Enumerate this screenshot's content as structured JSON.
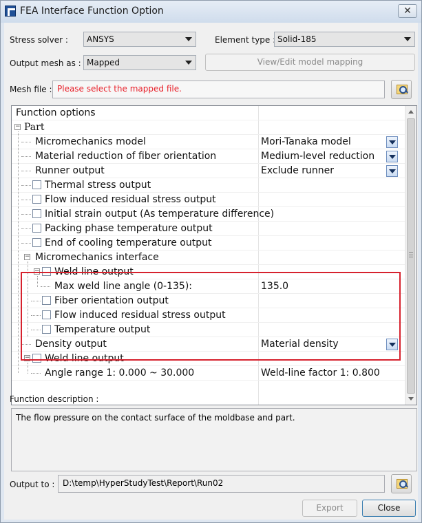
{
  "window": {
    "title": "FEA Interface Function Option",
    "close_glyph": "✕"
  },
  "stress_solver": {
    "label": "Stress solver :",
    "value": "ANSYS"
  },
  "element_type": {
    "label": "Element type :",
    "value": "Solid-185"
  },
  "output_mesh": {
    "label": "Output mesh as :",
    "value": "Mapped"
  },
  "view_edit_button": "View/Edit model mapping",
  "mesh_file": {
    "label": "Mesh file :",
    "value": "Please select the mapped file.",
    "value_color": "#e8212b"
  },
  "grid": {
    "header": "Function options",
    "rows": [
      {
        "text": "Part"
      },
      {
        "text": "Micromechanics model",
        "value": "Mori-Tanaka model"
      },
      {
        "text": "Material reduction of fiber orientation",
        "value": "Medium-level reduction"
      },
      {
        "text": "Runner output",
        "value": "Exclude runner"
      },
      {
        "text": "Thermal stress output"
      },
      {
        "text": "Flow induced residual stress output"
      },
      {
        "text": "Initial strain output (As temperature difference)"
      },
      {
        "text": "Packing phase temperature output"
      },
      {
        "text": "End of cooling temperature output"
      },
      {
        "text": "Micromechanics interface"
      },
      {
        "text": "Weld line output"
      },
      {
        "text": "Max weld line angle (0-135):",
        "value": "135.0"
      },
      {
        "text": "Fiber orientation output"
      },
      {
        "text": "Flow induced residual stress output"
      },
      {
        "text": "Temperature output"
      },
      {
        "text": "Density output",
        "value": "Material density"
      },
      {
        "text": "Weld line output"
      },
      {
        "text": "Angle range 1:  0.000 ~ 30.000",
        "value": "Weld-line factor 1: 0.800"
      }
    ],
    "highlight_color": "#d6212d"
  },
  "function_description": {
    "label": "Function description :",
    "text": "The flow pressure on the contact surface of the moldbase and part."
  },
  "output_to": {
    "label": "Output to :",
    "value": "D:\\temp\\HyperStudyTest\\Report\\Run02"
  },
  "buttons": {
    "export": "Export",
    "close": "Close"
  }
}
